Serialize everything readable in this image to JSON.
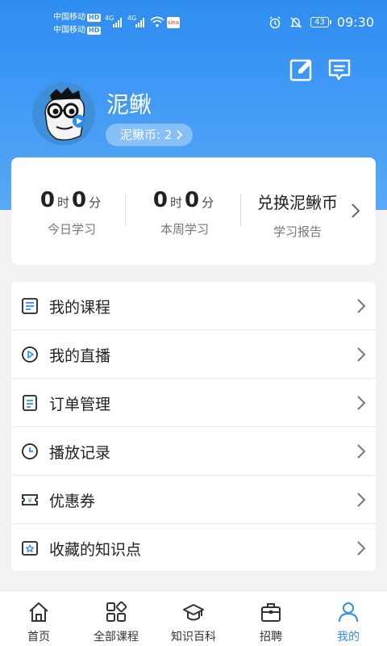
{
  "status_bar": {
    "carrier1": "中国移动",
    "carrier2": "中国移动",
    "hd": "HD",
    "net": "4G",
    "app_tag": "sina",
    "battery": "43",
    "time": "09:30"
  },
  "profile": {
    "nickname": "泥鳅",
    "coin_label": "泥鳅币: 2"
  },
  "stats": {
    "today": {
      "hours": "0",
      "hour_unit": "时",
      "minutes": "0",
      "minute_unit": "分",
      "label": "今日学习"
    },
    "week": {
      "hours": "0",
      "hour_unit": "时",
      "minutes": "0",
      "minute_unit": "分",
      "label": "本周学习"
    },
    "redeem": {
      "title": "兑换泥鳅币",
      "label": "学习报告"
    }
  },
  "menu": {
    "items": [
      {
        "label": "我的课程",
        "icon": "course-icon"
      },
      {
        "label": "我的直播",
        "icon": "live-icon"
      },
      {
        "label": "订单管理",
        "icon": "order-icon"
      },
      {
        "label": "播放记录",
        "icon": "history-icon"
      },
      {
        "label": "优惠券",
        "icon": "coupon-icon"
      },
      {
        "label": "收藏的知识点",
        "icon": "favorite-icon"
      }
    ]
  },
  "tabbar": {
    "tabs": [
      {
        "label": "首页",
        "icon": "home-icon"
      },
      {
        "label": "全部课程",
        "icon": "grid-icon"
      },
      {
        "label": "知识百科",
        "icon": "graduation-cap-icon"
      },
      {
        "label": "招聘",
        "icon": "briefcase-icon"
      },
      {
        "label": "我的",
        "icon": "user-icon"
      }
    ],
    "active": "我的"
  },
  "colors": {
    "primary": "#2e8df2",
    "background": "#f2f2f2",
    "card": "#ffffff"
  }
}
